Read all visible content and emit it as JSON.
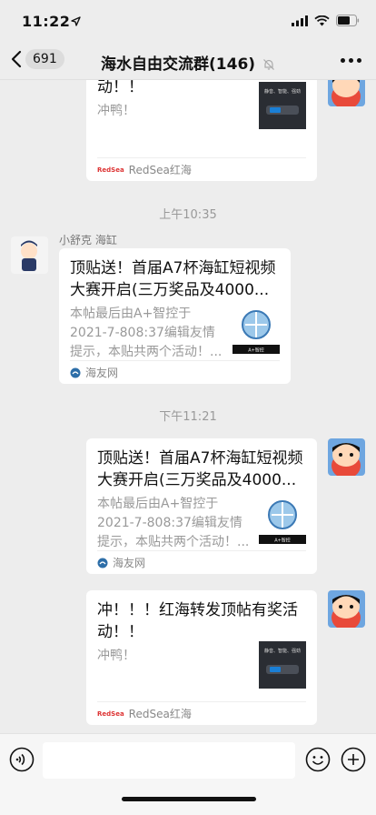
{
  "status_bar": {
    "time": "11:22"
  },
  "header": {
    "back_count": "691",
    "title": "海水自由交流群(146)"
  },
  "messages": [
    {
      "title": "动！！",
      "desc": "冲鸭！",
      "source": "RedSea红海",
      "source_logo_text": "RedSea"
    },
    {
      "timestamp": "上午10:35"
    },
    {
      "sender": "小舒克 海缸",
      "title": "顶贴送！首届A7杯海缸短视频大赛开启(三万奖品及4000...",
      "desc": "本帖最后由A+智控于2021-7-808:37编辑友情提示，本贴共两个活动！...",
      "source": "海友网"
    },
    {
      "timestamp": "下午11:21"
    },
    {
      "title": "顶贴送！首届A7杯海缸短视频大赛开启(三万奖品及4000...",
      "desc": "本帖最后由A+智控于2021-7-808:37编辑友情提示，本贴共两个活动！...",
      "source": "海友网"
    },
    {
      "title": "冲！！！红海转发顶帖有奖活动！！",
      "desc": "冲鸭！",
      "source": "RedSea红海",
      "source_logo_text": "RedSea"
    }
  ],
  "thumbs": {
    "redsea_caption": "静音、智能、强劲",
    "haiyou_caption": "A+智控"
  },
  "colors": {
    "background": "#ededed",
    "bubble": "#ffffff",
    "meta": "#999999"
  }
}
